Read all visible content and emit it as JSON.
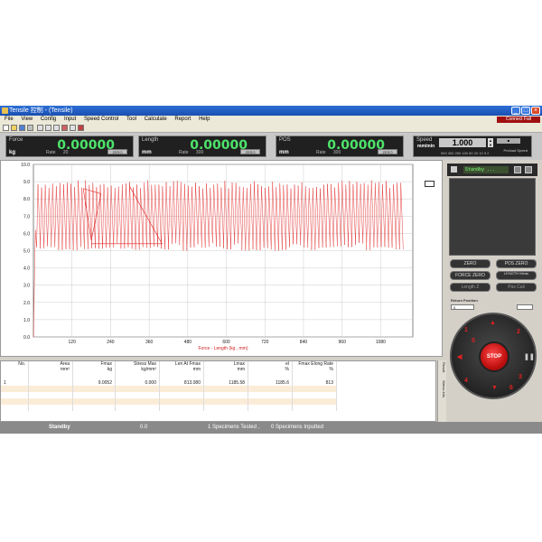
{
  "window": {
    "title": "Tensile 控制 - (Tensile)"
  },
  "menu": [
    "File",
    "View",
    "Config",
    "Input",
    "Speed Control",
    "Tool",
    "Calculate",
    "Report",
    "Help"
  ],
  "connect_label": "Connect Fail",
  "readouts": [
    {
      "label": "Force",
      "value": "0.00000",
      "unit": "kg",
      "rate_label": "Rate",
      "rate_value": "20",
      "zero": "ZERO"
    },
    {
      "label": "Length",
      "value": "0.00000",
      "unit": "mm",
      "rate_label": "Rate",
      "rate_value": "300",
      "zero": "ZERO"
    },
    {
      "label": "POS",
      "value": "0.00000",
      "unit": "mm",
      "rate_label": "Rate",
      "rate_value": "300",
      "zero": "ZERO"
    }
  ],
  "speed": {
    "label": "Speed",
    "value": "1.000",
    "unit": "mm/min",
    "preset_label": "Preload Speed",
    "scale": "500 300 200 100 50 20 10 5 2"
  },
  "panel": {
    "status": "Standby ...",
    "buttons": [
      "ZERO",
      "POS ZERO",
      "FORCE ZERO",
      "LENGTH Meas",
      "Length Z",
      "Pos Cali"
    ],
    "return_label": "Return Position",
    "return_value": "0",
    "stop_label": "STOP",
    "dial_numbers": [
      "1",
      "2",
      "3",
      "4",
      "5",
      "6"
    ]
  },
  "chart_data": {
    "type": "line",
    "xlabel": "Force - Length  (kg , mm)",
    "x_ticks": [
      120,
      240,
      360,
      480,
      600,
      720,
      840,
      960,
      1080
    ],
    "y_ticks": [
      "0.0",
      "1.0",
      "2.0",
      "3.0",
      "4.0",
      "5.0",
      "6.0",
      "7.0",
      "8.0",
      "9.0",
      "10.0"
    ],
    "xlim": [
      0,
      1180
    ],
    "ylim": [
      0,
      10
    ],
    "grid": true,
    "series": [
      {
        "color": "#e02020",
        "cycle_x_range": [
          10,
          1150
        ],
        "upper_range": [
          8.6,
          9.1
        ],
        "lower_range": [
          5.0,
          5.5
        ],
        "cycles": 100
      }
    ]
  },
  "table": {
    "headers": [
      "No.",
      "Area\nmm²",
      "Fmax\nkg",
      "Stress Max\nkg/mm²",
      "Len At Fmax\nmm",
      "Lmax\nmm",
      "el\n%",
      "Fmax Elong Rate\n%"
    ],
    "rows": [
      [
        "1",
        "",
        "9.0052",
        "0.000",
        "813.080",
        "1185.58",
        "1185.6",
        "813"
      ]
    ]
  },
  "side_tabs": [
    "Result",
    "Stress Info"
  ],
  "status": {
    "state": "Standby",
    "value": "0.0",
    "tested": "1   Specimens Tested ,",
    "inputted": "0  Specimens Inputted"
  },
  "colors": {
    "readout_green": "#4de36a",
    "stop_red": "#c01010",
    "curve_red": "#e02020"
  }
}
